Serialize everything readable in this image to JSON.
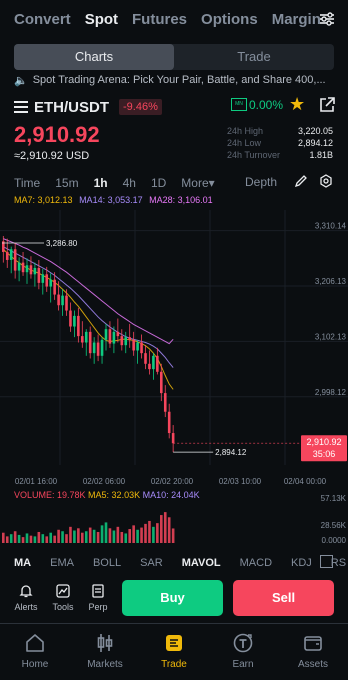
{
  "topnav": {
    "tabs": [
      "Convert",
      "Spot",
      "Futures",
      "Options",
      "Margin"
    ],
    "active": "Spot",
    "settings_icon": "settings-sliders-icon"
  },
  "segment": {
    "items": [
      "Charts",
      "Trade"
    ],
    "active": "Charts"
  },
  "announcement": {
    "icon": "speaker-icon",
    "text": "Spot Trading Arena: Pick Your Pair, Battle, and Share 400,..."
  },
  "pair": {
    "name": "ETH/USDT",
    "change": "-9.46%",
    "mn_badge": "MN",
    "mn_change": "0.00%",
    "price": "2,910.92",
    "sub_price": "≈2,910.92 USD",
    "stats": [
      {
        "label": "24h High",
        "value": "3,220.05"
      },
      {
        "label": "24h Low",
        "value": "2,894.12"
      },
      {
        "label": "24h Turnover",
        "value": "1.81B"
      }
    ]
  },
  "intervals": {
    "items": [
      "Time",
      "15m",
      "1h",
      "4h",
      "1D",
      "More▾"
    ],
    "active": "1h",
    "depth_label": "Depth"
  },
  "ma_legend": {
    "ma7": "MA7: 3,012.13",
    "ma14": "MA14: 3,053.17",
    "ma28": "MA28: 3,106.01"
  },
  "colors": {
    "up": "#0ecb81",
    "down": "#f6465d",
    "accent": "#f0b90b",
    "ma7": "#f0b90b",
    "ma14": "#a78bfa",
    "ma28": "#e879f9"
  },
  "chart_data": {
    "type": "candlestick",
    "y_ticks": [
      "3,310.14",
      "3,206.13",
      "3,102.13",
      "2,998.12"
    ],
    "x_ticks": [
      "02/01 16:00",
      "02/02 06:00",
      "02/02 20:00",
      "02/03 10:00",
      "02/04 00:00"
    ],
    "ylim": [
      2870,
      3330
    ],
    "high_marker": "3,286.80",
    "low_marker": "2,894.12",
    "current_price": "2,910.92",
    "countdown": "35:06",
    "candles": [
      [
        3290,
        3300,
        3250,
        3270
      ],
      [
        3270,
        3295,
        3240,
        3255
      ],
      [
        3255,
        3280,
        3230,
        3275
      ],
      [
        3275,
        3286.8,
        3220,
        3235
      ],
      [
        3235,
        3260,
        3215,
        3250
      ],
      [
        3250,
        3270,
        3225,
        3232
      ],
      [
        3232,
        3258,
        3210,
        3245
      ],
      [
        3245,
        3262,
        3220,
        3228
      ],
      [
        3228,
        3250,
        3205,
        3240
      ],
      [
        3240,
        3255,
        3200,
        3212
      ],
      [
        3212,
        3238,
        3190,
        3228
      ],
      [
        3228,
        3242,
        3195,
        3205
      ],
      [
        3205,
        3230,
        3175,
        3218
      ],
      [
        3218,
        3232,
        3180,
        3190
      ],
      [
        3190,
        3215,
        3160,
        3170
      ],
      [
        3170,
        3200,
        3150,
        3188
      ],
      [
        3188,
        3200,
        3150,
        3160
      ],
      [
        3160,
        3175,
        3120,
        3130
      ],
      [
        3130,
        3160,
        3110,
        3150
      ],
      [
        3150,
        3165,
        3100,
        3112
      ],
      [
        3112,
        3140,
        3090,
        3100
      ],
      [
        3100,
        3125,
        3075,
        3120
      ],
      [
        3120,
        3130,
        3070,
        3080
      ],
      [
        3080,
        3110,
        3060,
        3100
      ],
      [
        3100,
        3115,
        3065,
        3075
      ],
      [
        3075,
        3110,
        3060,
        3105
      ],
      [
        3105,
        3135,
        3085,
        3125
      ],
      [
        3125,
        3140,
        3090,
        3098
      ],
      [
        3098,
        3130,
        3080,
        3120
      ],
      [
        3120,
        3145,
        3100,
        3112
      ],
      [
        3112,
        3125,
        3085,
        3095
      ],
      [
        3095,
        3120,
        3080,
        3110
      ],
      [
        3110,
        3135,
        3090,
        3105
      ],
      [
        3105,
        3120,
        3075,
        3085
      ],
      [
        3085,
        3105,
        3060,
        3100
      ],
      [
        3100,
        3115,
        3070,
        3080
      ],
      [
        3080,
        3095,
        3050,
        3060
      ],
      [
        3060,
        3085,
        3040,
        3050
      ],
      [
        3050,
        3080,
        3030,
        3075
      ],
      [
        3075,
        3090,
        3040,
        3045
      ],
      [
        3045,
        3060,
        2990,
        3005
      ],
      [
        3005,
        3020,
        2960,
        2970
      ],
      [
        2970,
        2985,
        2920,
        2930
      ],
      [
        2930,
        2945,
        2894.12,
        2910.92
      ]
    ],
    "ma7": [
      3275,
      3268,
      3262,
      3255,
      3250,
      3244,
      3240,
      3236,
      3233,
      3230,
      3226,
      3222,
      3218,
      3213,
      3207,
      3200,
      3193,
      3185,
      3176,
      3168,
      3158,
      3148,
      3138,
      3128,
      3118,
      3110,
      3104,
      3102,
      3103,
      3104,
      3106,
      3106,
      3105,
      3104,
      3101,
      3098,
      3094,
      3088,
      3080,
      3070,
      3055,
      3038,
      3022,
      3012
    ],
    "ma14": [
      3280,
      3276,
      3272,
      3268,
      3264,
      3260,
      3256,
      3252,
      3248,
      3244,
      3240,
      3236,
      3231,
      3226,
      3220,
      3214,
      3208,
      3202,
      3195,
      3188,
      3180,
      3172,
      3164,
      3156,
      3148,
      3141,
      3135,
      3129,
      3124,
      3119,
      3115,
      3111,
      3108,
      3106,
      3104,
      3102,
      3100,
      3097,
      3093,
      3088,
      3080,
      3072,
      3062,
      3053
    ],
    "ma28": [
      3295,
      3292,
      3289,
      3286,
      3283,
      3279,
      3276,
      3272,
      3268,
      3264,
      3260,
      3256,
      3252,
      3247,
      3242,
      3237,
      3232,
      3226,
      3220,
      3214,
      3208,
      3202,
      3196,
      3190,
      3184,
      3178,
      3172,
      3166,
      3160,
      3154,
      3149,
      3144,
      3139,
      3134,
      3130,
      3126,
      3122,
      3118,
      3114,
      3110,
      3106,
      3102,
      3098,
      3106.01
    ]
  },
  "volume": {
    "legend": {
      "vol": "VOLUME: 19.78K",
      "ma5": "MA5: 32.03K",
      "ma10": "MA10: 24.04K"
    },
    "y_ticks": [
      "57.13K",
      "28.56K",
      "0.0000"
    ],
    "max": 57130,
    "values": [
      14000,
      9000,
      12000,
      16000,
      11000,
      8000,
      13000,
      10000,
      9000,
      15000,
      12000,
      9000,
      14000,
      10000,
      18000,
      16000,
      12000,
      22000,
      17000,
      20000,
      14000,
      16000,
      21000,
      18000,
      15000,
      24000,
      28000,
      20000,
      17000,
      22000,
      15000,
      13000,
      19000,
      24000,
      18000,
      21000,
      26000,
      30000,
      22000,
      27000,
      38000,
      42000,
      35000,
      19780
    ]
  },
  "indicators": {
    "items": [
      "MA",
      "EMA",
      "BOLL",
      "SAR",
      "MAVOL",
      "MACD",
      "KDJ",
      "RS"
    ],
    "active": [
      "MA",
      "MAVOL"
    ]
  },
  "tools": [
    {
      "label": "Alerts",
      "icon": "bell-icon"
    },
    {
      "label": "Tools",
      "icon": "chart-tools-icon"
    },
    {
      "label": "Perp",
      "icon": "perp-icon"
    }
  ],
  "actions": {
    "buy": "Buy",
    "sell": "Sell"
  },
  "bottomnav": {
    "items": [
      {
        "label": "Home",
        "icon": "home-icon"
      },
      {
        "label": "Markets",
        "icon": "markets-icon"
      },
      {
        "label": "Trade",
        "icon": "trade-icon"
      },
      {
        "label": "Earn",
        "icon": "earn-icon"
      },
      {
        "label": "Assets",
        "icon": "wallet-icon"
      }
    ],
    "active": "Trade"
  }
}
